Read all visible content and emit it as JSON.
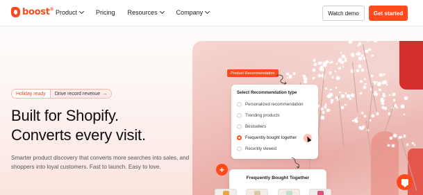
{
  "header": {
    "logo_text": "boost",
    "logo_mark": "®",
    "nav": [
      {
        "label": "Product",
        "has_dropdown": true
      },
      {
        "label": "Pricing",
        "has_dropdown": false
      },
      {
        "label": "Resources",
        "has_dropdown": true
      },
      {
        "label": "Company",
        "has_dropdown": true
      }
    ],
    "watch_demo": "Watch demo",
    "get_started": "Get started"
  },
  "hero": {
    "pill_left": "Holiday ready",
    "pill_right": "Drive record revenue",
    "pill_arrow": "→",
    "headline_line1": "Built for Shopify.",
    "headline_line2": "Converts every visit.",
    "subtext": "Smarter product discovery that converts more searches into sales, and shoppers into loyal customers. Fast to launch. Easy to love."
  },
  "widget": {
    "tag": "Product Recommendation",
    "card_title": "Select Recommendation type",
    "options": [
      {
        "label": "Personalized recommendation",
        "selected": false
      },
      {
        "label": "Trending products",
        "selected": false
      },
      {
        "label": "Bestsellers",
        "selected": false
      },
      {
        "label": "Frequently bought together",
        "selected": true
      },
      {
        "label": "Recently viewed",
        "selected": false
      }
    ],
    "plus": "+",
    "fbt_title": "Frequently Bought Together"
  },
  "colors": {
    "accent": "#ff4a1c"
  },
  "icons": {
    "chat": "chat-bubble-icon",
    "chevron": "chevron-down-icon",
    "cursor": "pointer-cursor-icon"
  }
}
